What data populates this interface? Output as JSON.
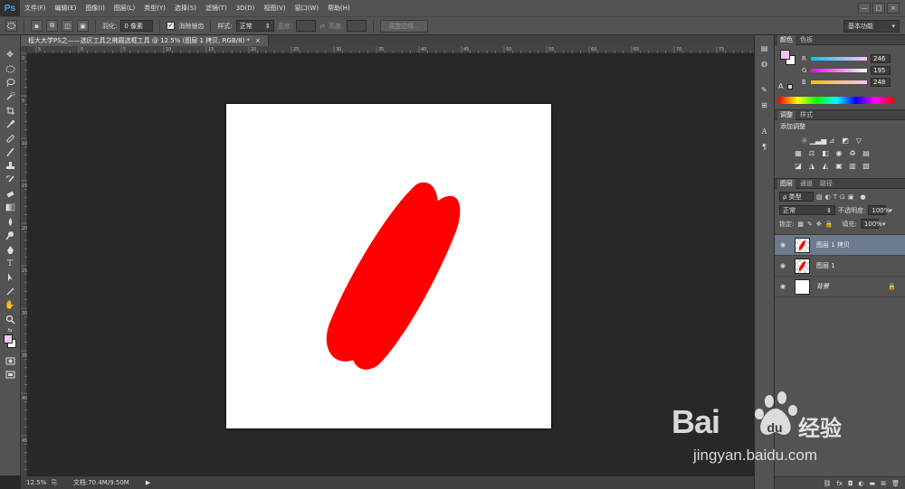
{
  "app": {
    "logo": "Ps"
  },
  "menus": [
    "文件(F)",
    "编辑(E)",
    "图像(I)",
    "图层(L)",
    "类型(Y)",
    "选择(S)",
    "滤镜(T)",
    "3D(D)",
    "视图(V)",
    "窗口(W)",
    "帮助(H)"
  ],
  "window_buttons": [
    "—",
    "□",
    "×"
  ],
  "options": {
    "feather_label": "羽化:",
    "feather_value": "0 像素",
    "antialias_label": "消除锯齿",
    "antialias_checked": true,
    "style_label": "样式:",
    "style_value": "正常",
    "width_label": "宽度:",
    "height_label": "高度:",
    "refine_edge_label": "调整边缘...",
    "workspace": "基本功能"
  },
  "document": {
    "tab_title": "程大大学PS之——选区工具之椭圆选框工具 @ 12.5% (图层 1 拷贝, RGB/8) *",
    "tab_close": "×",
    "canvas_bg": "#ffffff",
    "shape_color": "#ff0000"
  },
  "rulers": {
    "top": [
      "5",
      "0",
      "5",
      "10",
      "15",
      "20",
      "25",
      "30",
      "35",
      "40",
      "45",
      "50",
      "55",
      "60",
      "65",
      "70",
      "75"
    ],
    "left": [
      "0",
      "5",
      "10",
      "15",
      "20",
      "25",
      "30",
      "35",
      "40",
      "45",
      "50"
    ]
  },
  "status": {
    "zoom": "12.5%",
    "doc_info": "文档:70.4M/9.50M"
  },
  "color_panel": {
    "tabs": [
      "颜色",
      "色板"
    ],
    "channels": [
      {
        "name": "R",
        "value": "246"
      },
      {
        "name": "G",
        "value": "195"
      },
      {
        "name": "B",
        "value": "248"
      }
    ],
    "foreground": "#f6c3f8",
    "background": "#ffffff"
  },
  "adjust_panel": {
    "tabs": [
      "调整",
      "样式"
    ],
    "title": "添加调整"
  },
  "layers_panel": {
    "tabs": [
      "图层",
      "通道",
      "路径"
    ],
    "filter_label": "ρ 类型",
    "blend_mode": "正常",
    "opacity_label": "不透明度:",
    "opacity_value": "100%",
    "lock_label": "锁定:",
    "fill_label": "填充:",
    "fill_value": "100%",
    "layers": [
      {
        "name": "图层 1 拷贝",
        "selected": true
      },
      {
        "name": "图层 1",
        "selected": false
      },
      {
        "name": "背景",
        "selected": false,
        "locked": true
      }
    ]
  },
  "watermark": {
    "brand": "Bai",
    "brand2": "经验",
    "url": "jingyan.baidu.com"
  }
}
